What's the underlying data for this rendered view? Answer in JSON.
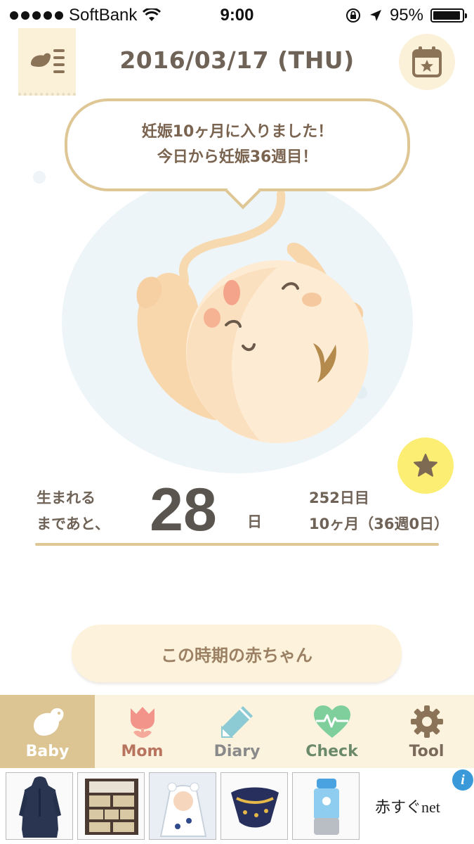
{
  "status_bar": {
    "carrier": "SoftBank",
    "time": "9:00",
    "battery": "95%",
    "battery_level": 0.95
  },
  "header": {
    "date": "2016/03/17 (THU)",
    "menu_icon": "menu-list-icon",
    "calendar_icon": "calendar-star-icon"
  },
  "bubble": {
    "line1": "妊娠10ヶ月に入りました！",
    "line2": "今日から妊娠36週目！"
  },
  "illustration": {
    "subject": "fetus-illustration"
  },
  "favorite": {
    "icon": "star-icon"
  },
  "countdown": {
    "label_line1": "生まれる",
    "label_line2": "まであと、",
    "days": "28",
    "unit": "日",
    "day_count": "252日目",
    "month_week": "10ヶ月（36週0日）"
  },
  "baby_button": {
    "label": "この時期の赤ちゃん"
  },
  "tabs": [
    {
      "label": "Baby",
      "icon": "bird-icon",
      "active": true
    },
    {
      "label": "Mom",
      "icon": "tulip-icon",
      "active": false
    },
    {
      "label": "Diary",
      "icon": "pencil-icon",
      "active": false
    },
    {
      "label": "Check",
      "icon": "heart-pulse-icon",
      "active": false
    },
    {
      "label": "Tool",
      "icon": "gear-icon",
      "active": false
    }
  ],
  "ad": {
    "brand": "赤すぐnet",
    "info_icon": "i",
    "products": [
      "hooded-dress",
      "toy-shelf",
      "baby-poncho",
      "baby-sling",
      "sippy-bottle"
    ]
  },
  "colors": {
    "accent_gold": "#dec695",
    "cream": "#fbf1d8",
    "active_tab": "#dcc593",
    "favorite_yellow": "#fcee72",
    "text_brown": "#6f6256"
  }
}
